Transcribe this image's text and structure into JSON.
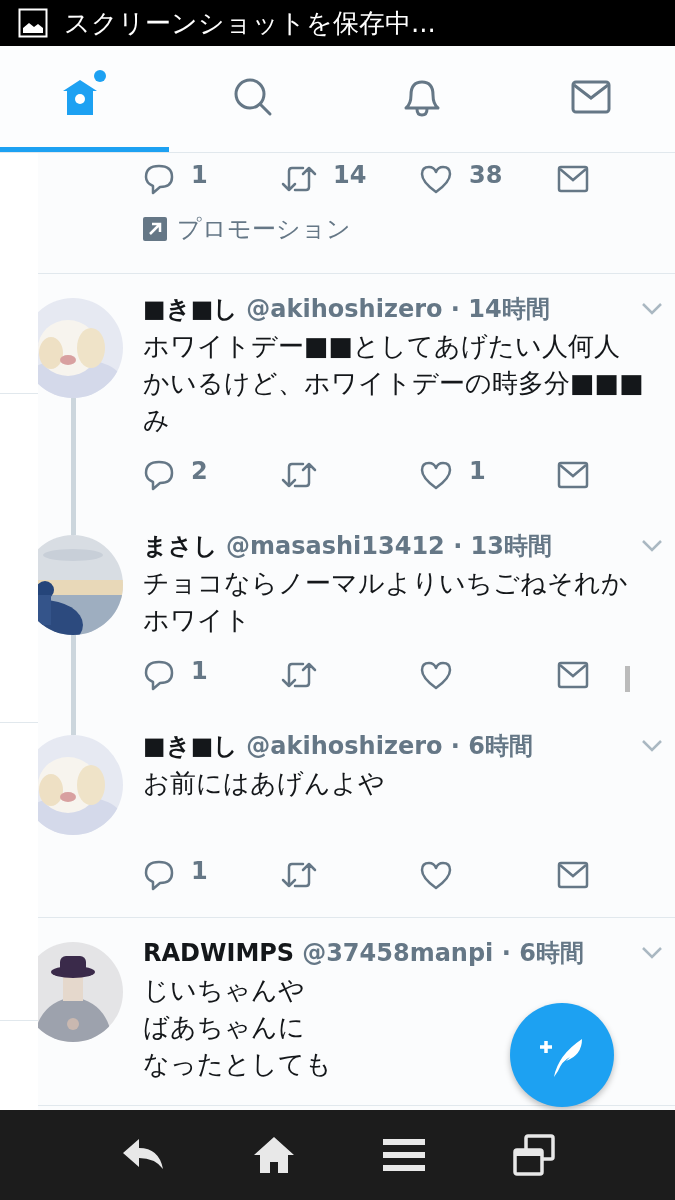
{
  "status_bar": {
    "text": "スクリーンショットを保存中..."
  },
  "tabs": [
    {
      "kind": "home",
      "selected": true,
      "badge": true
    },
    {
      "kind": "search",
      "selected": false,
      "badge": false
    },
    {
      "kind": "notifications",
      "selected": false,
      "badge": false
    },
    {
      "kind": "messages",
      "selected": false,
      "badge": false
    }
  ],
  "promoted_tail": {
    "actions": [
      {
        "kind": "reply",
        "count": "1"
      },
      {
        "kind": "retweet",
        "count": "14"
      },
      {
        "kind": "like",
        "count": "38"
      },
      {
        "kind": "dm"
      }
    ],
    "label": "プロモーション"
  },
  "tweets": [
    {
      "name": "■き■し",
      "byline": "@akihoshizero · 14時間",
      "lines": [
        "ホワイトデー■■としてあげたい人何人",
        "かいるけど、ホワイトデーの時多分■■■",
        "み"
      ],
      "thread_next": true,
      "actions": [
        {
          "kind": "reply",
          "count": "2"
        },
        {
          "kind": "retweet"
        },
        {
          "kind": "like",
          "count": "1"
        },
        {
          "kind": "dm"
        }
      ]
    },
    {
      "name": "まさし",
      "byline": "@masashi13412 · 13時間",
      "lines": [
        "チョコならノーマルよりいちごねそれか",
        "ホワイト"
      ],
      "thread_next": true,
      "actions": [
        {
          "kind": "reply",
          "count": "1"
        },
        {
          "kind": "retweet"
        },
        {
          "kind": "like"
        },
        {
          "kind": "dm"
        }
      ]
    },
    {
      "name": "■き■し",
      "byline": "@akihoshizero · 6時間",
      "lines": [
        "お前にはあげんよや"
      ],
      "thread_next": false,
      "actions": [
        {
          "kind": "reply",
          "count": "1"
        },
        {
          "kind": "retweet"
        },
        {
          "kind": "like"
        },
        {
          "kind": "dm"
        }
      ]
    },
    {
      "name": "RADWIMPS",
      "byline": "@37458manpi · 6時間",
      "lines": [
        "じいちゃんや",
        "ばあちゃんに",
        "なったとしても"
      ],
      "thread_next": false
    }
  ],
  "nav_bar": [
    {
      "kind": "back"
    },
    {
      "kind": "home"
    },
    {
      "kind": "menu"
    },
    {
      "kind": "windows"
    }
  ]
}
